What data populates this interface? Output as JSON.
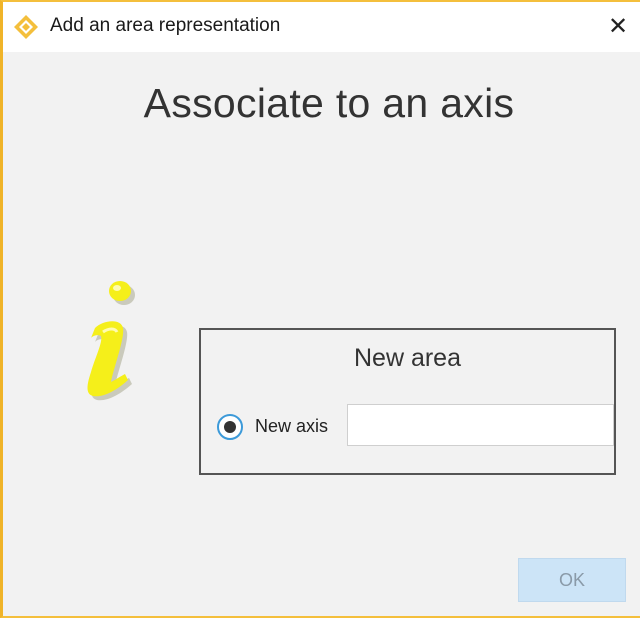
{
  "window": {
    "title": "Add an area representation",
    "close_glyph": "✕",
    "app_icon": "diamond-logo-icon",
    "accent_color": "#f4bf3c"
  },
  "main": {
    "heading": "Associate to an axis",
    "info_icon": "info-icon",
    "info_icon_color": "#f5ef1a"
  },
  "group": {
    "title": "New area",
    "radio_label": "New axis",
    "radio_selected": true,
    "axis_input_value": "",
    "axis_input_placeholder": ""
  },
  "footer": {
    "ok_label": "OK",
    "ok_enabled": false
  }
}
